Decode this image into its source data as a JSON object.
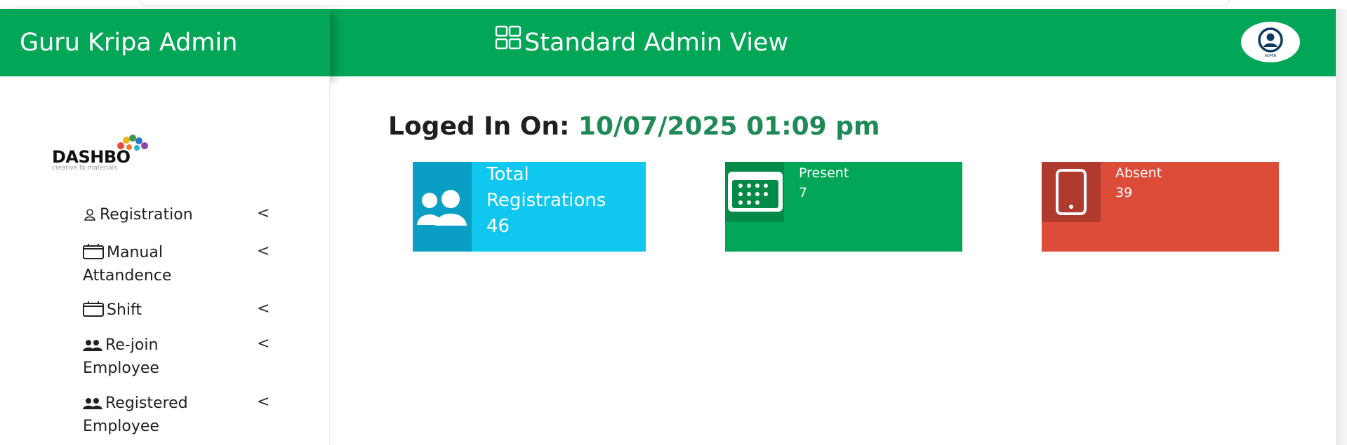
{
  "header": {
    "brand": "Guru Kripa Admin",
    "view_title": "Standard Admin View",
    "avatar_caption": "ADMIN"
  },
  "logo": {
    "word": "DASHBO",
    "tagline": "creative fx materials"
  },
  "sidebar": {
    "items": [
      {
        "line1": "Registration",
        "line2": "",
        "icon": "user-icon"
      },
      {
        "line1": "Manual",
        "line2": "Attandence",
        "icon": "calendar-icon"
      },
      {
        "line1": "Shift",
        "line2": "",
        "icon": "calendar-icon"
      },
      {
        "line1": "Re-join",
        "line2": "Employee",
        "icon": "users-icon"
      },
      {
        "line1": "Registered",
        "line2": "Employee",
        "icon": "users-icon"
      }
    ],
    "chevron": "<"
  },
  "login": {
    "label": "Loged In On:",
    "datetime": "10/07/2025 01:09 pm"
  },
  "cards": {
    "total": {
      "line1": "Total",
      "line2": "Registrations",
      "value": "46",
      "icon": "users-icon",
      "color": "#10c8ef"
    },
    "present": {
      "label": "Present",
      "value": "7",
      "icon": "calendar-icon",
      "color": "#02a657"
    },
    "absent": {
      "label": "Absent",
      "value": "39",
      "icon": "mobile-icon",
      "color": "#dd4b39"
    }
  }
}
